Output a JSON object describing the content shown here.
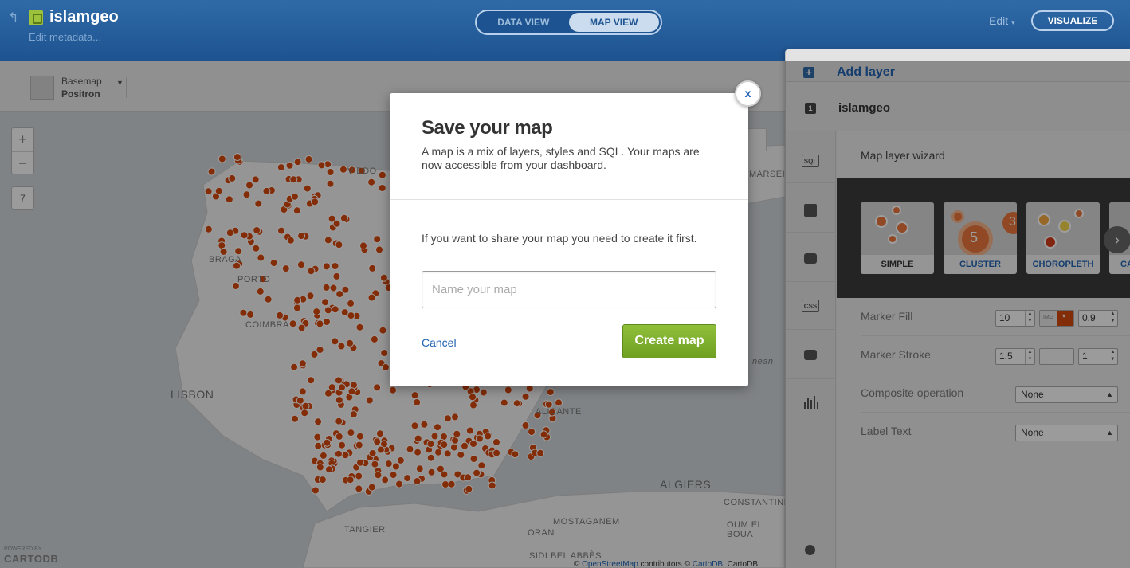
{
  "header": {
    "back_icon": "back-arrow-icon",
    "lock_icon": "lock-icon",
    "title": "islamgeo",
    "edit_metadata": "Edit metadata...",
    "tabs": [
      {
        "label": "DATA VIEW"
      },
      {
        "label": "MAP VIEW",
        "active": true
      }
    ],
    "edit_label": "Edit",
    "visualize_label": "VISUALIZE"
  },
  "basemap": {
    "label": "Basemap",
    "value": "Positron"
  },
  "map": {
    "zoom_in": "+",
    "zoom_out": "−",
    "zoom_level": "7",
    "labels": {
      "braga": "BRAGA",
      "porto": "PORTO",
      "coimbra": "COIMBRA",
      "lisbon": "LISBON",
      "algiers": "ALGIERS",
      "constantine": "CONSTANTINE",
      "oum_el_bouaghi": "OUM EL BOUA",
      "mostaganem": "MOSTAGANEM",
      "oran": "ORAN",
      "tangier": "TANGIER",
      "sidi_bel_abbes": "SIDI BEL ABBÈS",
      "marseille": "MARSEILLE",
      "alicante": "ALICANTE",
      "oviedo": "VIEDO",
      "mediterranean": "nean"
    },
    "attribution": {
      "prefix": "©",
      "osm": "OpenStreetMap",
      "contributors": "contributors ©",
      "cartodb_link": "CartoDB",
      "suffix": ", CartoDB"
    },
    "powered_by": "POWERED BY",
    "logo": "CARTODB",
    "marker_color": "#d3480d"
  },
  "panel": {
    "add_layer": "Add layer",
    "layer_number": "1",
    "layer_name": "islamgeo",
    "rail_icons": [
      "sql-icon",
      "wizard-icon",
      "infowindow-icon",
      "css-icon",
      "legend-icon",
      "filters-icon",
      "pin-icon"
    ],
    "rail_labels": {
      "sql": "SQL",
      "css": "CSS"
    },
    "wizard_title": "Map layer wizard",
    "wizards": [
      {
        "label": "SIMPLE",
        "selected": true
      },
      {
        "label": "CLUSTER",
        "number": "5",
        "number2": "3"
      },
      {
        "label": "CHOROPLETH"
      },
      {
        "label": "CA"
      }
    ],
    "next_icon": "chevron-right-icon",
    "properties": [
      {
        "label": "Marker Fill",
        "size": "10",
        "img": "IMG",
        "opacity": "0.9"
      },
      {
        "label": "Marker Stroke",
        "size": "1.5",
        "opacity": "1"
      },
      {
        "label": "Composite operation",
        "value": "None"
      },
      {
        "label": "Label Text",
        "value": "None"
      }
    ]
  },
  "modal": {
    "title": "Save your map",
    "description": "A map is a mix of layers, styles and SQL. Your maps are now accessible from your dashboard.",
    "hint": "If you want to share your map you need to create it first.",
    "input_placeholder": "Name your map",
    "input_value": "",
    "cancel_label": "Cancel",
    "create_label": "Create map",
    "close_label": "x"
  }
}
